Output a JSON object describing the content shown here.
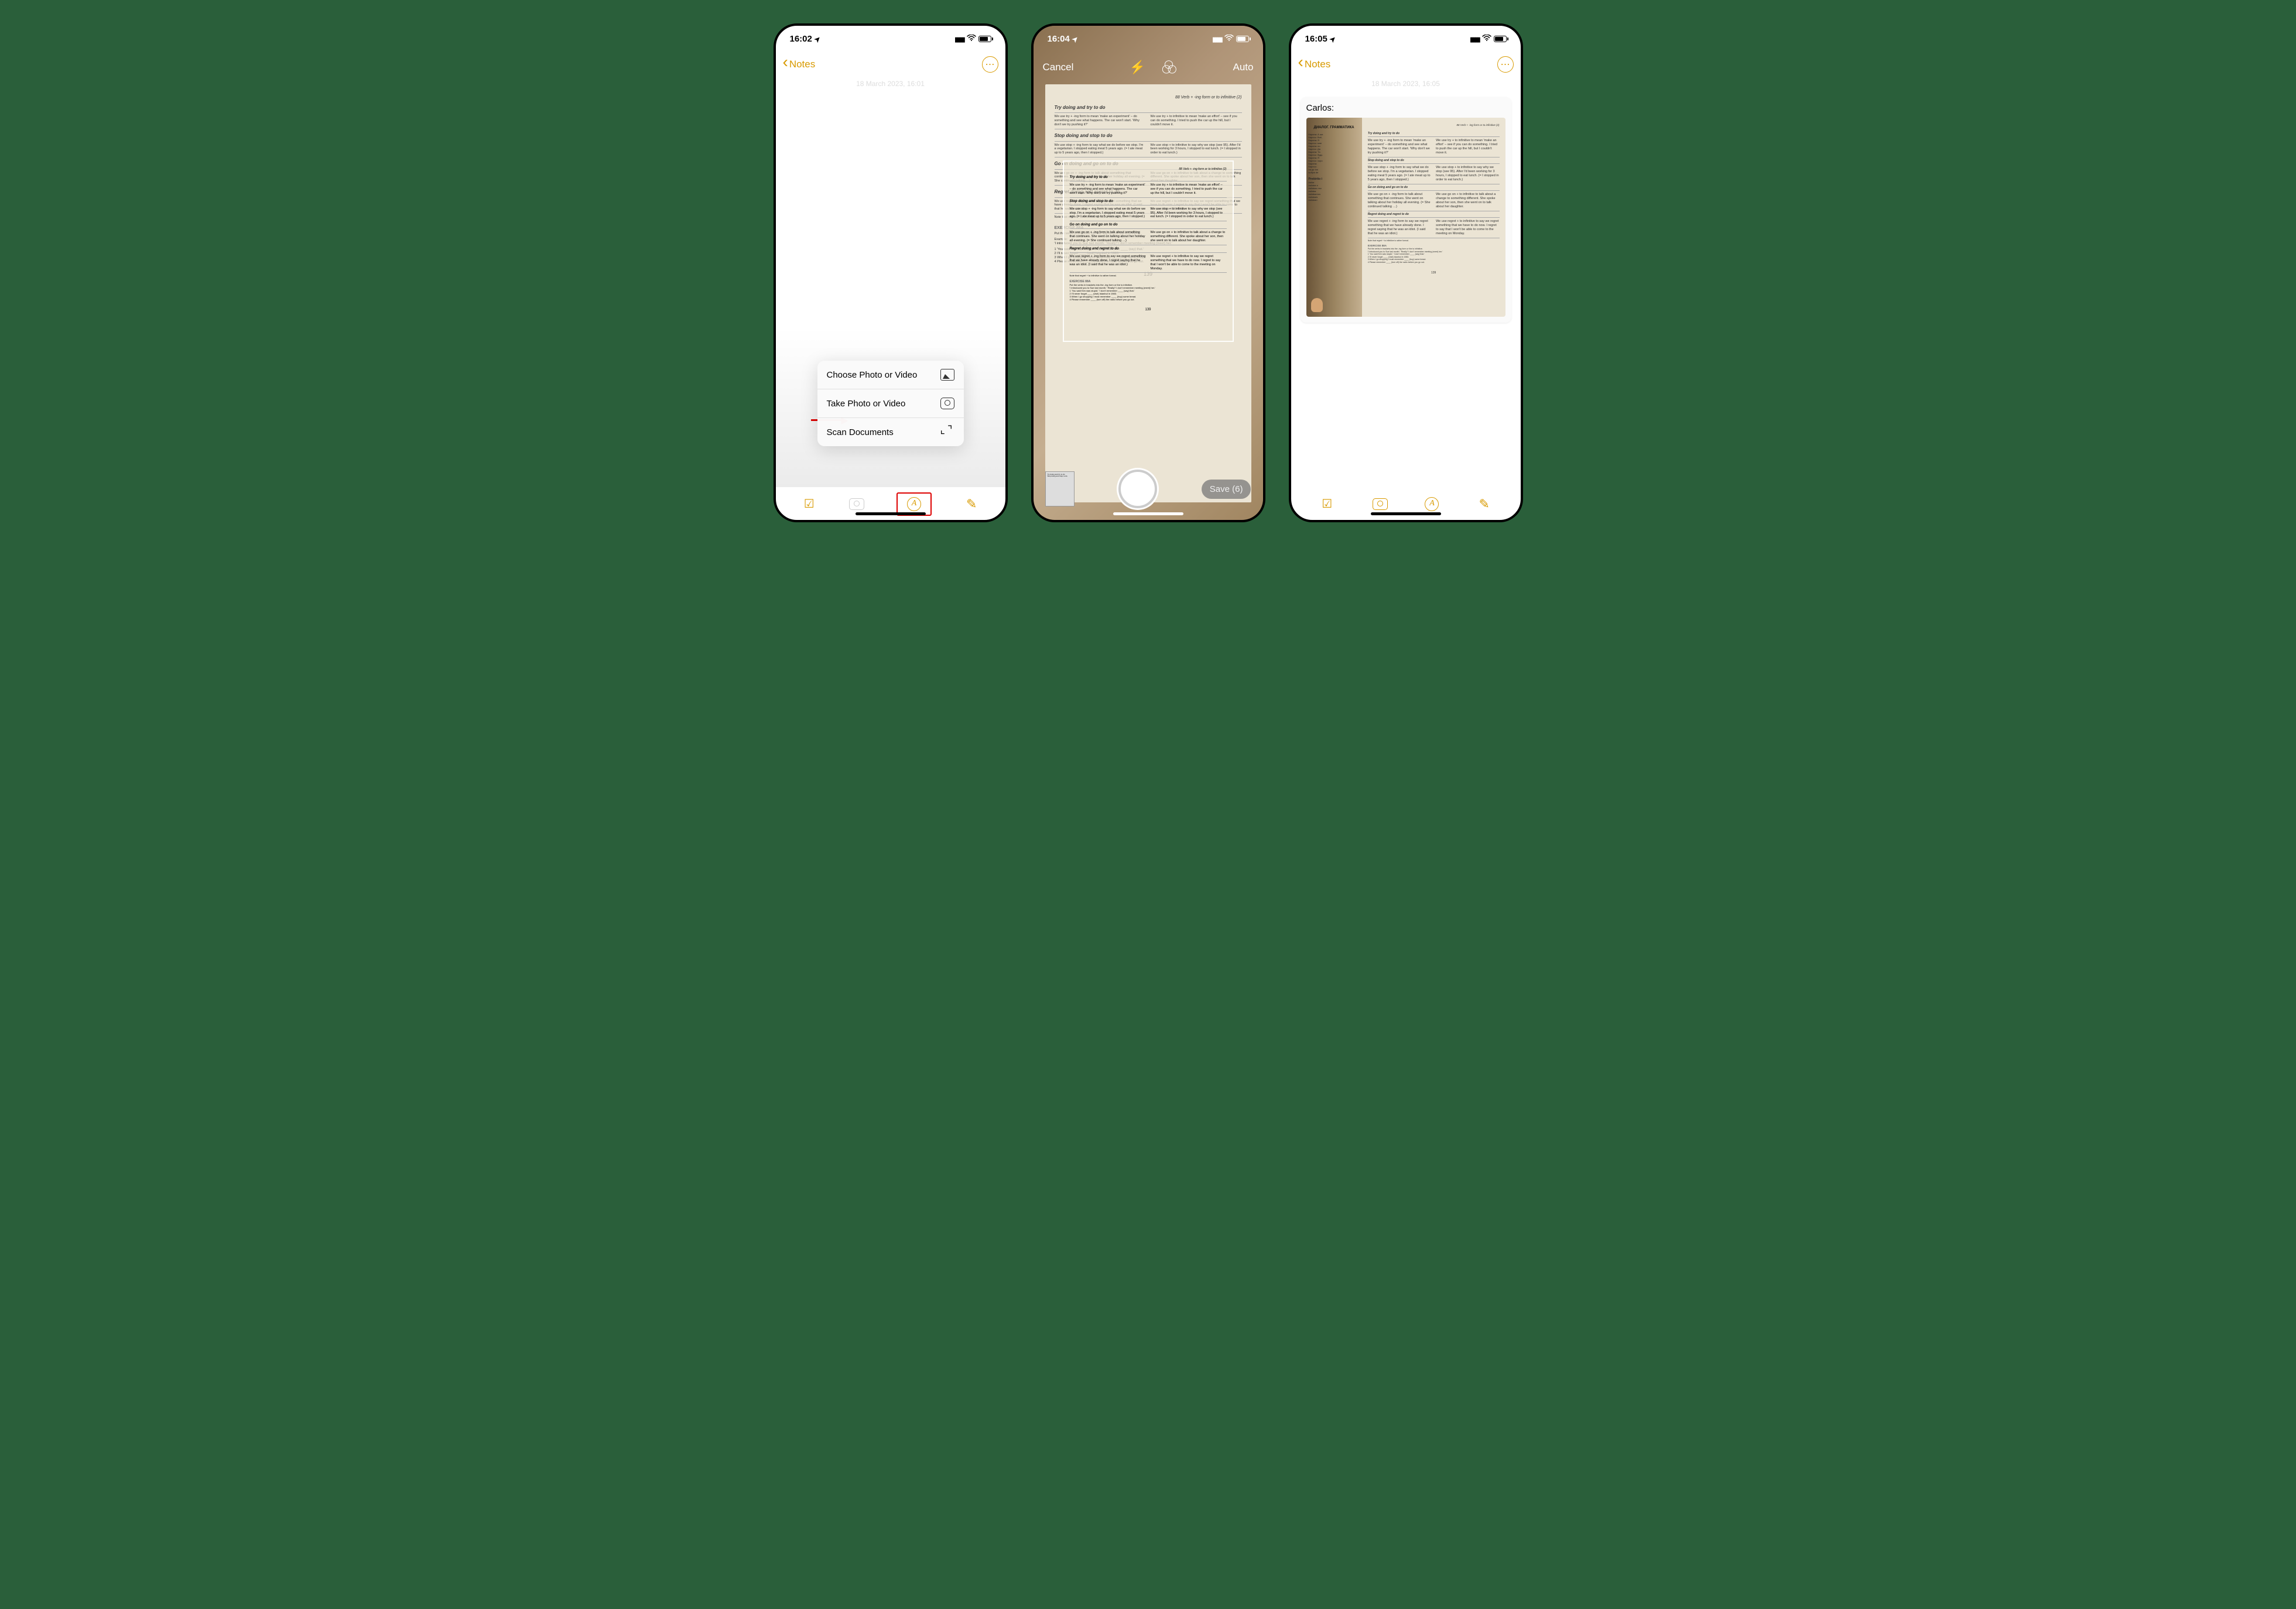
{
  "screen1": {
    "status": {
      "time": "16:02"
    },
    "nav": {
      "back": "Notes"
    },
    "faint_date": "18 March 2023, 16:01",
    "actions": {
      "choose": "Choose Photo or Video",
      "take": "Take Photo or Video",
      "scan": "Scan Documents"
    }
  },
  "screen2": {
    "status": {
      "time": "16:04"
    },
    "nav": {
      "cancel": "Cancel",
      "auto": "Auto"
    },
    "save": "Save (6)",
    "page_number": "139",
    "page_header": "88   Verb + -ing form or to infinitive (2)",
    "section1": {
      "title": "Try doing and try to do",
      "left": "We use try + -ing form to mean 'make an experiment' – do something and see what happens.\nThe car won't start.   'Why don't we try pushing it?'",
      "right": "We use try + to infinitive to mean 'make an effort' – see if you can do something.\nI tried to push the car up the hill, but I couldn't move it."
    },
    "section2": {
      "title": "Stop doing and stop to do",
      "left": "We use stop + -ing form to say what we do before we stop.\nI'm a vegetarian. I stopped eating meat 5 years ago. (= I ate meat up to 5 years ago, then I stopped.)",
      "right": "We use stop + to infinitive to say why we stop (see 95).\nAfter I'd been working for 3 hours, I stopped to eat lunch. (= I stopped in order to eat lunch.)"
    },
    "section3": {
      "title": "Go on doing and go on to do",
      "left": "We use go on + -ing form to talk about something that continues.\nShe went on talking about her holiday all evening. (= She continued talking …)",
      "right": "We use go on + to infinitive to talk about a change to something different.\nShe spoke about her son, then she went on to talk about her daughter."
    },
    "section4": {
      "title": "Regret doing and regret to do",
      "left": "We use regret + -ing form to say we regret something that we have already done.\nI regret saying that he was an idiot. (I said that he was an idiot.)",
      "right": "We use regret + to infinitive to say we regret something that we have to do now.\nI regret to say that I won't be able to come to the meeting on Monday."
    },
    "note": "Note that regret + to infinitive is rather formal.",
    "exercise": {
      "heading": "EXERCISE 88A",
      "instruction": "Put the verbs in brackets into the -ing form or the to infinitive.",
      "example_label": "Example:",
      "example": "'I introduced you to Sue last month.'   'Really? I don't remember meeting (meet) her.'",
      "items": [
        "1 'You said Ken was stupid.' 'I don't remember ____ (say) that.'",
        "2 I'll never forget ____ (visit) Istanbul in 1983.",
        "3 When I go shopping I must remember ____ (buy) some bread.",
        "4 Please remember ____ (turn off) the radio before you go out."
      ]
    }
  },
  "screen3": {
    "status": {
      "time": "16:05"
    },
    "nav": {
      "back": "Notes"
    },
    "faint_date": "18 March 2023, 16:05",
    "author": "Carlos:",
    "left_page": {
      "header": "ДИАЛОГ. ГРАММАТИКА",
      "lines": [
        "Карина: А ши",
        "Карлос: Всё,",
        "Карина: Я",
        "Карлос: мне",
        "Карина: но",
        "Карлос: Да",
        "Карина: Та",
        "Карлос: будь",
        "Карина: Я",
        "Карлос: хоро",
        "Карина:",
        "Карлос:",
        "на де los",
        "sufijos de"
      ],
      "preterito": "Pretérito i",
      "conjugation": [
        "bailar",
        "bailaba  я",
        "bailabas ты",
        "bailaba",
        "bailábamos",
        "bailabais",
        "bailaban"
      ]
    },
    "page_number": "139"
  }
}
